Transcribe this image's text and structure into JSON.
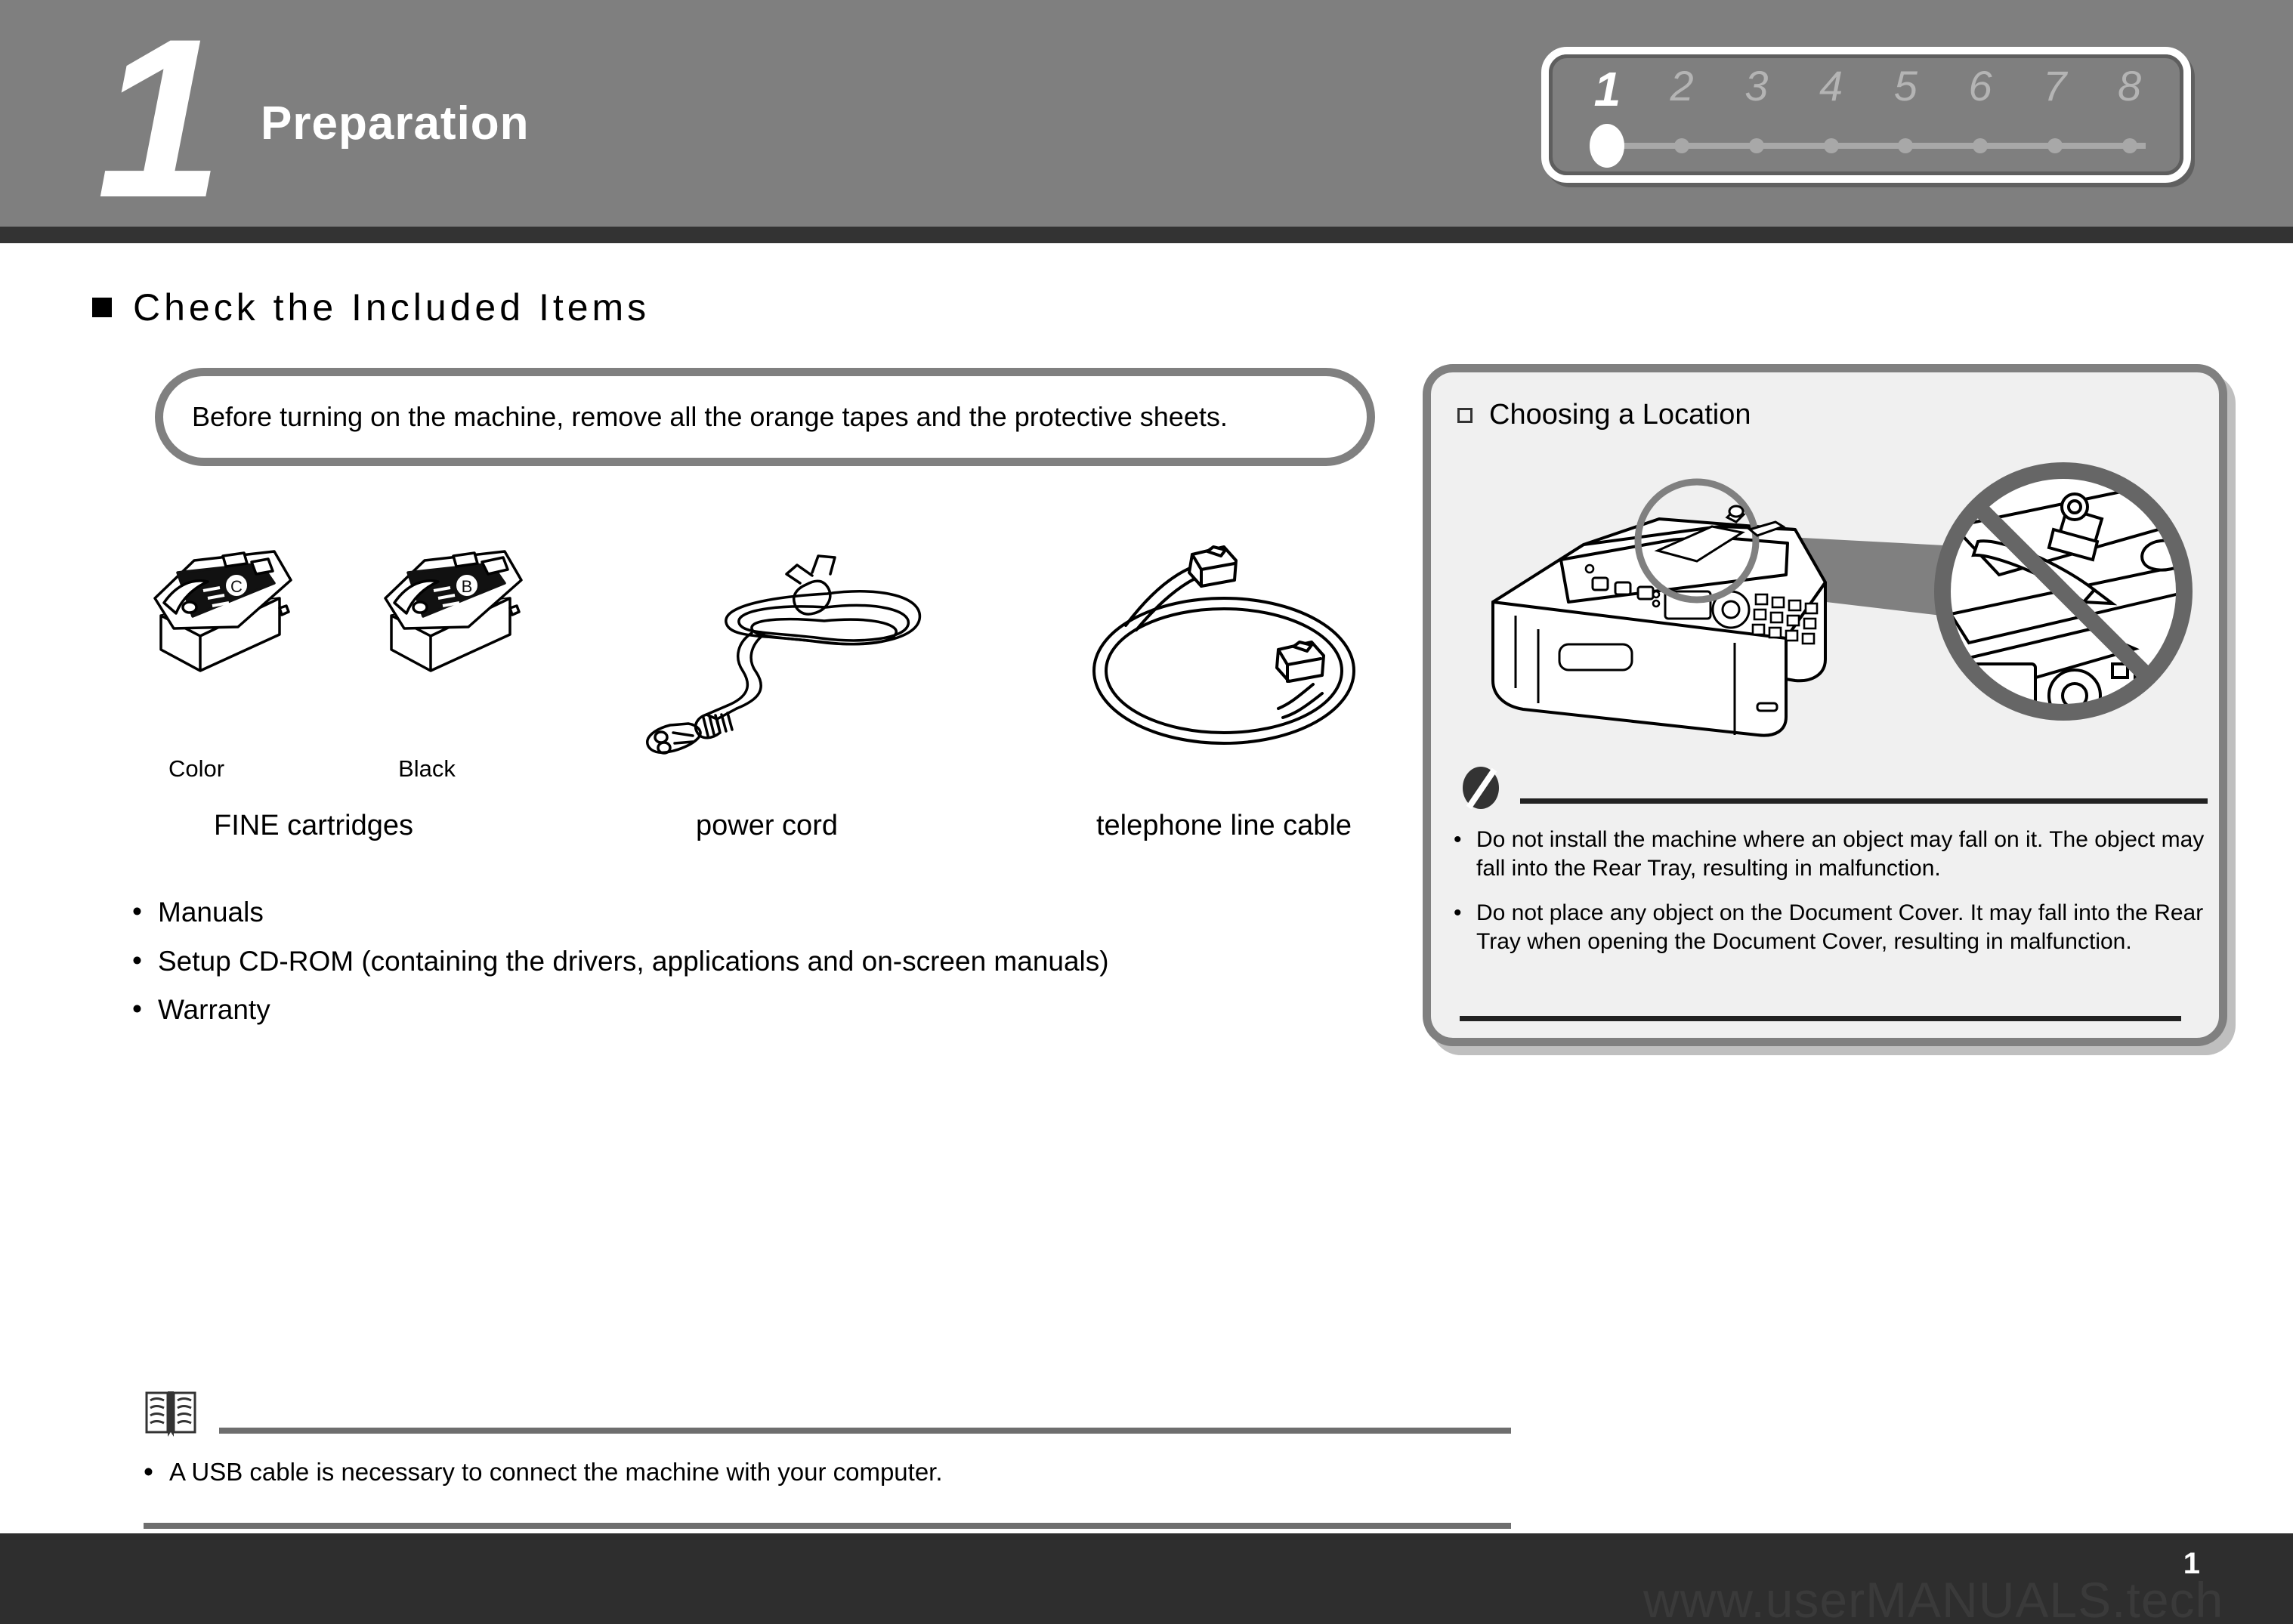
{
  "header": {
    "step_number": "1",
    "title": "Preparation",
    "stepper": {
      "steps": [
        "1",
        "2",
        "3",
        "4",
        "5",
        "6",
        "7",
        "8"
      ],
      "active_index": 0
    }
  },
  "section": {
    "title": "Check the Included Items",
    "bullet_icon": "filled-square-bullet"
  },
  "notice": {
    "text": "Before turning on the machine, remove all the orange tapes and the protective sheets."
  },
  "items": [
    {
      "id": "fine-cartridge-color",
      "icon": "ink-cartridge-icon",
      "badge": "C",
      "caption": "Color"
    },
    {
      "id": "fine-cartridge-black",
      "icon": "ink-cartridge-icon",
      "badge": "B",
      "caption": "Black"
    }
  ],
  "item_group_labels": {
    "cartridges": "FINE cartridges",
    "power_cord": "power cord",
    "telephone_line_cable": "telephone line cable"
  },
  "included_list": [
    "Manuals",
    "Setup CD-ROM (containing the drivers, applications and on-screen manuals)",
    "Warranty"
  ],
  "footnote": {
    "icon": "manual-book-icon",
    "items": [
      "A USB cable is necessary to connect the machine with your computer."
    ]
  },
  "location_panel": {
    "title": "Choosing a Location",
    "bullet_icon": "hollow-square-bullet",
    "warning_icon": "prohibition-icon",
    "warnings": [
      "Do not install the machine where an object may fall on it. The object may fall into the Rear Tray, resulting in malfunction.",
      "Do not place any object on the Document Cover. It may fall into the Rear Tray when opening the Document Cover, resulting in malfunction."
    ]
  },
  "footer": {
    "page_number": "1",
    "watermark": "www.userMANUALS.tech"
  },
  "colors": {
    "header_gray": "#7f7f7f",
    "header_stripe": "#333333",
    "panel_fill": "#f0f0f0",
    "panel_border": "#808080",
    "footer_bar": "#2e2e2e",
    "text": "#000000"
  }
}
